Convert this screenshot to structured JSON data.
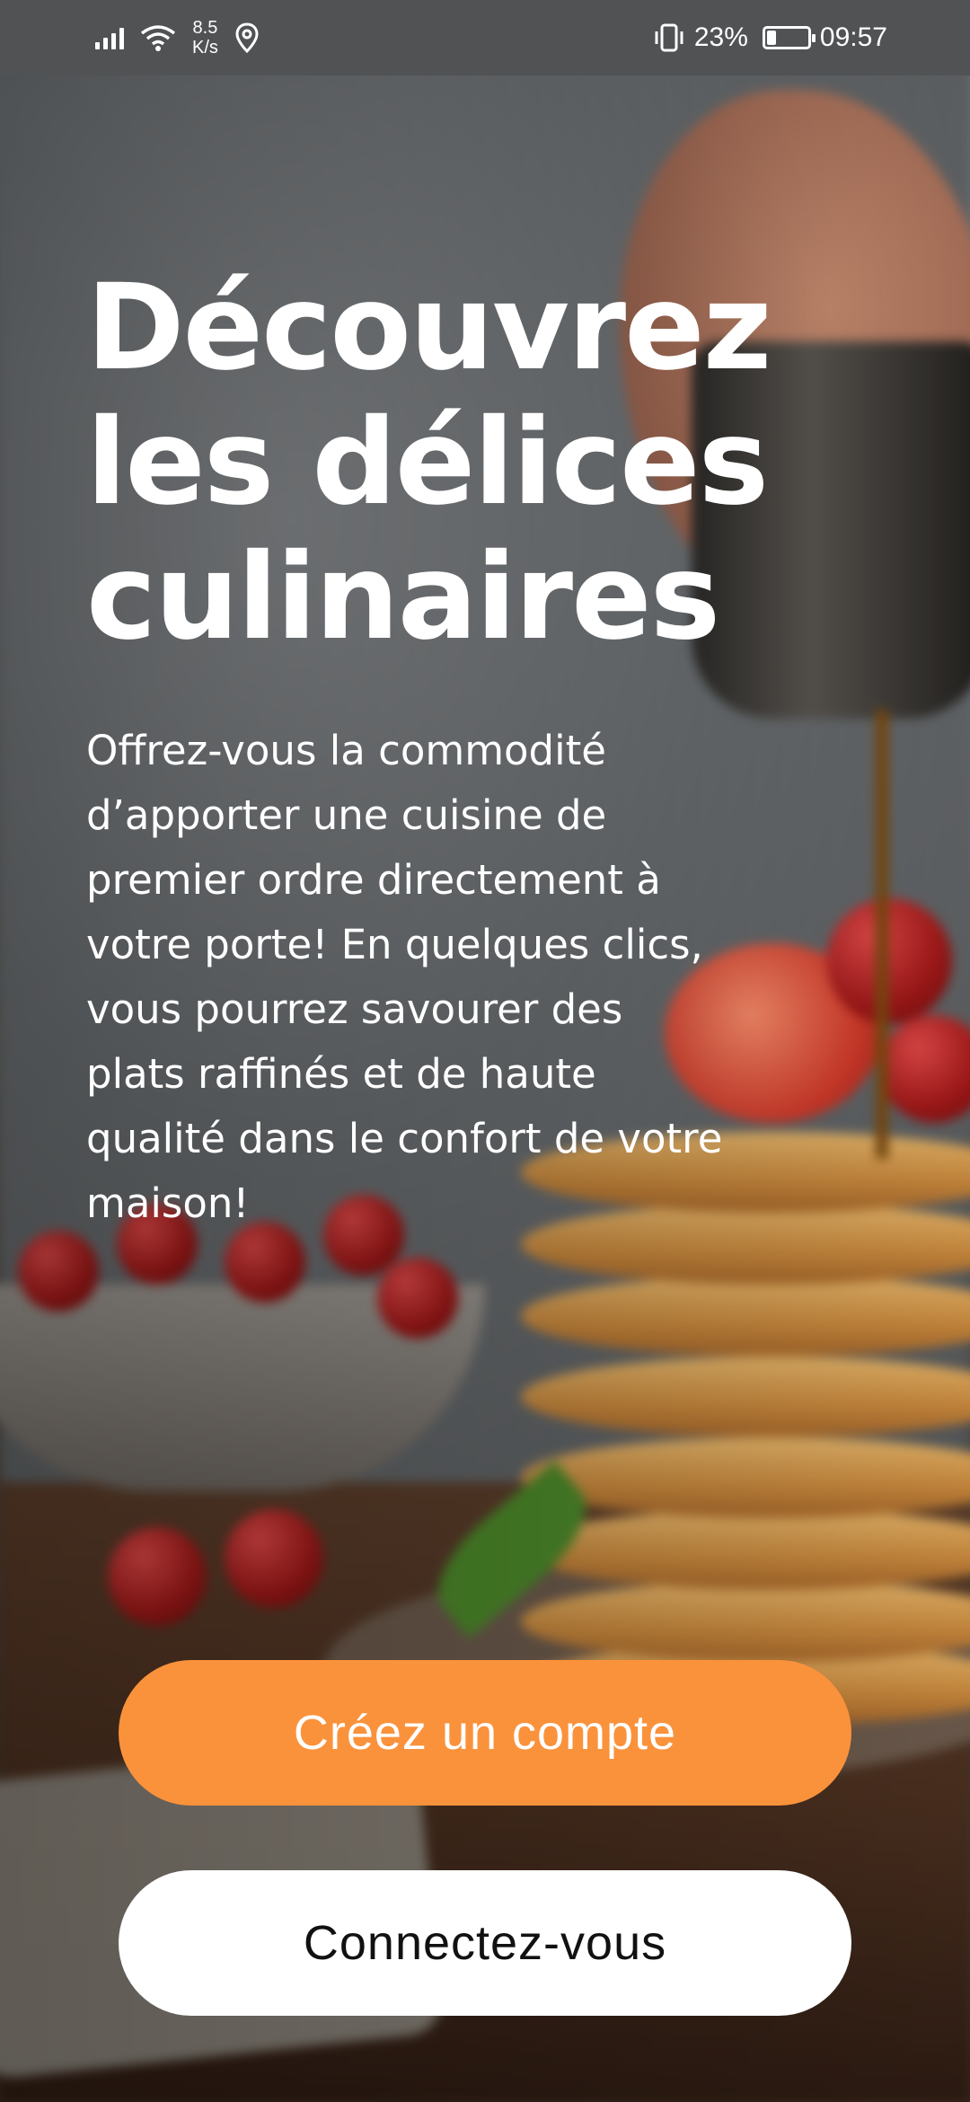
{
  "status_bar": {
    "speed_value": "8.5",
    "speed_unit": "K/s",
    "battery_percent_text": "23%",
    "battery_level": 0.23,
    "time": "09:57"
  },
  "hero": {
    "title_line1": "Découvrez",
    "title_line2": "les délices",
    "title_line3": "culinaires",
    "description_lines": [
      "Offrez-vous la commodité",
      "d’apporter une cuisine de",
      "premier ordre directement à",
      "votre porte! En quelques clics,",
      "vous pourrez savourer des",
      "plats raffinés et de haute",
      "qualité dans le confort de votre",
      "maison!"
    ]
  },
  "actions": {
    "create_account_label": "Créez un compte",
    "login_label": "Connectez-vous"
  },
  "colors": {
    "primary": "#fa923c",
    "secondary": "#ffffff"
  },
  "icons": {
    "signal": "signal-icon",
    "wifi": "wifi-icon",
    "location": "location-icon",
    "vibrate": "vibrate-icon",
    "battery": "battery-icon"
  }
}
